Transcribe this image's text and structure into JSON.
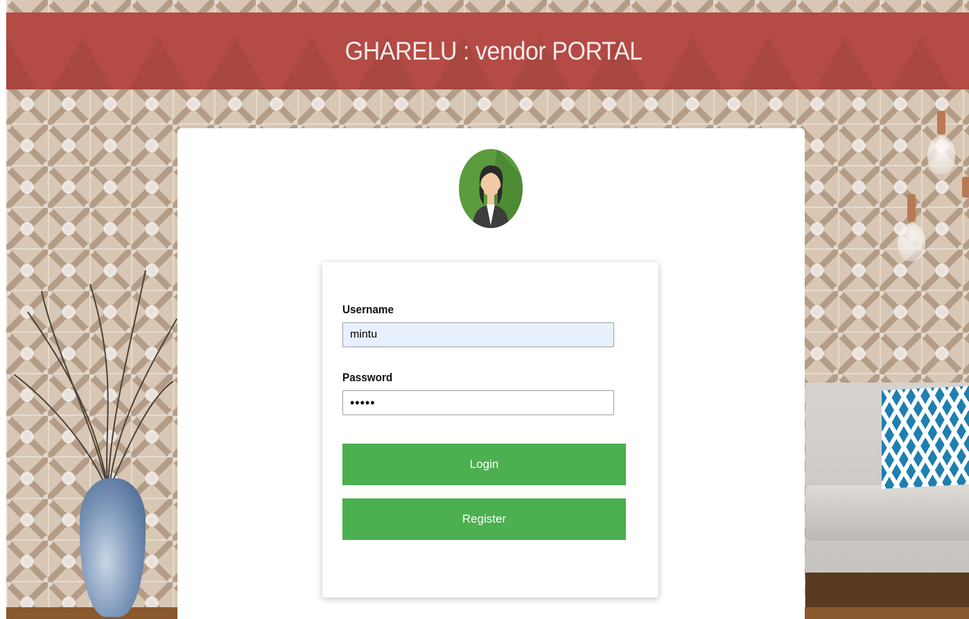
{
  "header": {
    "title": "GHARELU : vendor PORTAL"
  },
  "avatar": {
    "icon": "user-avatar-icon"
  },
  "login_form": {
    "username_label": "Username",
    "username_value": "mintu",
    "password_label": "Password",
    "password_value": "•••••",
    "login_label": "Login",
    "register_label": "Register"
  },
  "colors": {
    "header_bg": "#b44b45",
    "button_bg": "#4caf50",
    "avatar_bg": "#5a9c3e",
    "input_autofill_bg": "#e8f0fe"
  }
}
